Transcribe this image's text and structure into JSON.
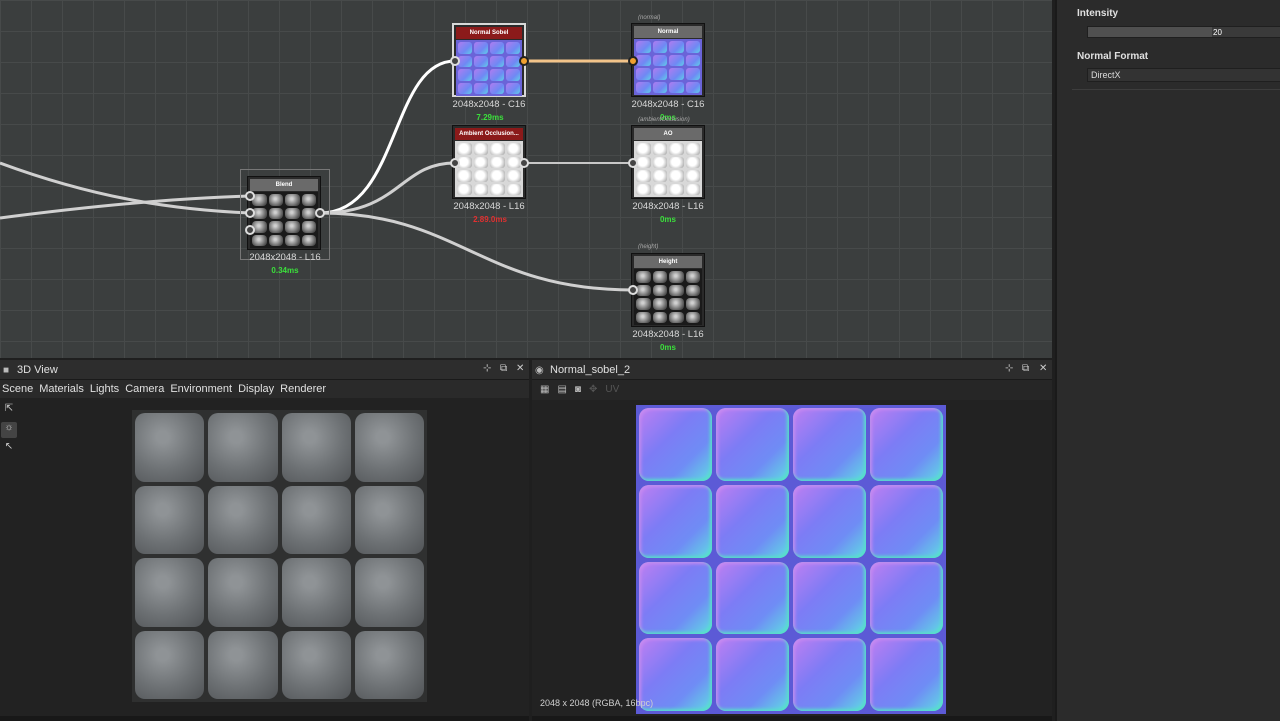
{
  "graph": {
    "nodes": {
      "blend": {
        "title": "Blend",
        "size": "2048x2048 - L16",
        "time": "0.34ms"
      },
      "normal_sobel": {
        "title": "Normal Sobel",
        "size": "2048x2048 - C16",
        "time": "7.29ms"
      },
      "ambient_occlusion": {
        "title": "Ambient Occlusion...",
        "size": "2048x2048 - L16",
        "time": "2.89.0ms"
      },
      "normal_out": {
        "tag": "(normal)",
        "title": "Normal",
        "size": "2048x2048 - C16",
        "time": "0ms"
      },
      "ao_out": {
        "tag": "(ambientOcclusion)",
        "title": "AO",
        "size": "2048x2048 - L16",
        "time": "0ms"
      },
      "height_out": {
        "tag": "(height)",
        "title": "Height",
        "size": "2048x2048 - L16",
        "time": "0ms"
      }
    },
    "colors": {
      "title_red": "#8b1a1a",
      "title_gray": "#6a6a6a",
      "selected_wire": "#f3c48a",
      "ok": "#3be03b",
      "error": "#e23030"
    }
  },
  "properties": {
    "intensity_label": "Intensity",
    "intensity_value": "20",
    "intensity_fraction": 0.64,
    "normal_format_label": "Normal Format",
    "normal_format_value": "DirectX"
  },
  "view3d": {
    "title": "3D View",
    "menu": [
      "Scene",
      "Materials",
      "Lights",
      "Camera",
      "Environment",
      "Display",
      "Renderer"
    ]
  },
  "view2d": {
    "title": "Normal_sobel_2",
    "uv_label": "UV",
    "status": "2048 x 2048 (RGBA, 16bpc)"
  },
  "icons": [
    "pin-icon",
    "float-icon",
    "close-icon",
    "camera-icon",
    "cube-icon",
    "select-tool-icon"
  ]
}
